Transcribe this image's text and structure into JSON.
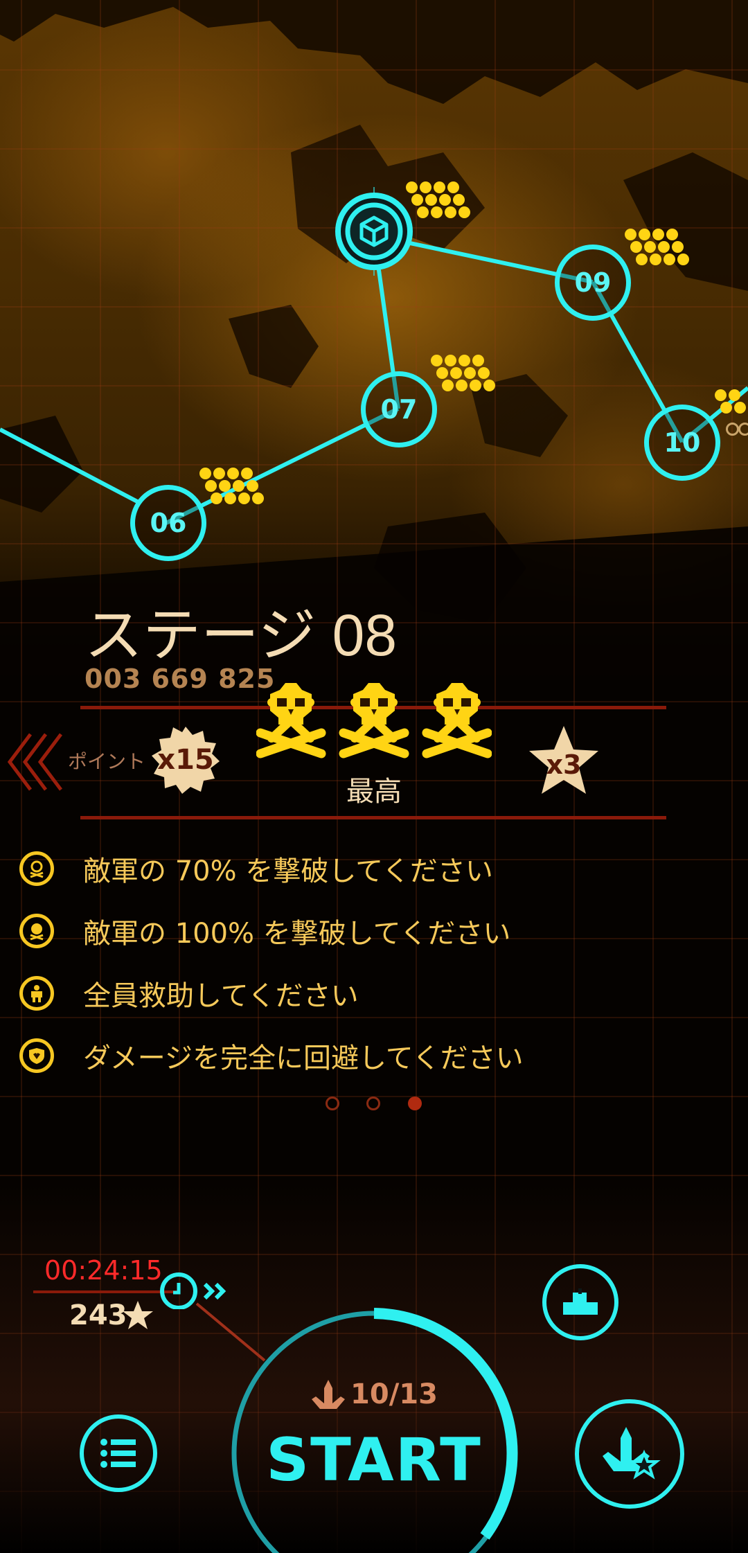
{
  "map": {
    "nodes": [
      {
        "label": "06"
      },
      {
        "label": "07"
      },
      {
        "label": "09"
      },
      {
        "label": "10"
      }
    ],
    "current_node_icon": "cube-icon"
  },
  "stage": {
    "title": "ステージ 08",
    "high_score": "003 669 825"
  },
  "rewards": {
    "points_label": "ポイント",
    "points_multiplier": "x15",
    "difficulty_label": "最高",
    "difficulty_skulls": 3,
    "star_multiplier": "x3"
  },
  "objectives": [
    {
      "icon": "skull-icon",
      "text": "敵軍の 70% を撃破してください"
    },
    {
      "icon": "skull-full-icon",
      "text": "敵軍の 100% を撃破してください"
    },
    {
      "icon": "rescue-person-icon",
      "text": "全員救助してください"
    },
    {
      "icon": "shield-heart-icon",
      "text": "ダメージを完全に回避してください"
    }
  ],
  "pagination": {
    "total": 3,
    "active": 3
  },
  "timer": {
    "value": "00:24:15",
    "stars": "243"
  },
  "start": {
    "squad": "10/13",
    "label": "START"
  },
  "colors": {
    "accent": "#2ff0f0",
    "gold": "#ffd414",
    "timer": "#ff2a2a",
    "text": "#f6c95a",
    "divider": "#8a1a0a"
  }
}
